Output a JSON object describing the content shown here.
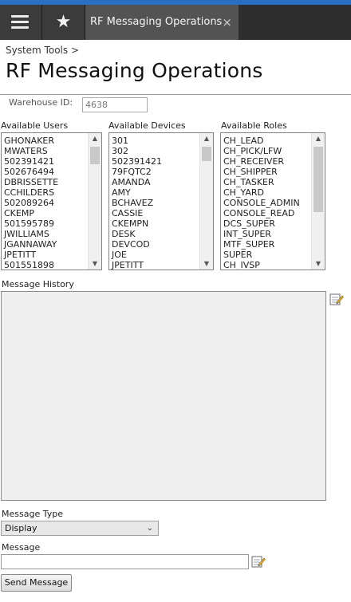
{
  "header": {
    "tab_title": "RF Messaging Operations",
    "tab_close": "×",
    "menu_icon": "hamburger-menu-icon",
    "star_icon": "star-icon",
    "star_glyph": "★"
  },
  "breadcrumb": "System Tools >",
  "page_title": "RF Messaging Operations",
  "warehouse": {
    "label": "Warehouse ID:",
    "value": "4638"
  },
  "lists": {
    "users": {
      "label": "Available Users",
      "items": [
        "GHONAKER",
        "MWATERS",
        "502391421",
        "502676494",
        "DBRISSETTE",
        "CCHILDERS",
        "502089264",
        "CKEMP",
        "501595789",
        "JWILLIAMS",
        "JGANNAWAY",
        "JPETITT",
        "501551898"
      ]
    },
    "devices": {
      "label": "Available Devices",
      "items": [
        "301",
        "302",
        "502391421",
        "79FQTC2",
        "AMANDA",
        "AMY",
        "BCHAVEZ",
        "CASSIE",
        "CKEMPN",
        "DESK",
        "DEVCOD",
        "JOE",
        "JPETITT"
      ]
    },
    "roles": {
      "label": "Available Roles",
      "items": [
        "CH_LEAD",
        "CH_PICK/LFW",
        "CH_RECEIVER",
        "CH_SHIPPER",
        "CH_TASKER",
        "CH_YARD",
        "CONSOLE_ADMIN",
        "CONSOLE_READ",
        "DCS_SUPER",
        "INT_SUPER",
        "MTF_SUPER",
        "SUPER",
        "CH_IVSP"
      ]
    }
  },
  "message_history": {
    "label": "Message History",
    "icon": "edit-note-icon"
  },
  "message_type": {
    "label": "Message Type",
    "selected": "Display"
  },
  "message": {
    "label": "Message",
    "value": "",
    "icon": "edit-note-icon"
  },
  "send_button": "Send Message",
  "colors": {
    "accent_strip": "#2a6fc4",
    "topbar": "#2d2d2d",
    "tab": "#535353"
  }
}
